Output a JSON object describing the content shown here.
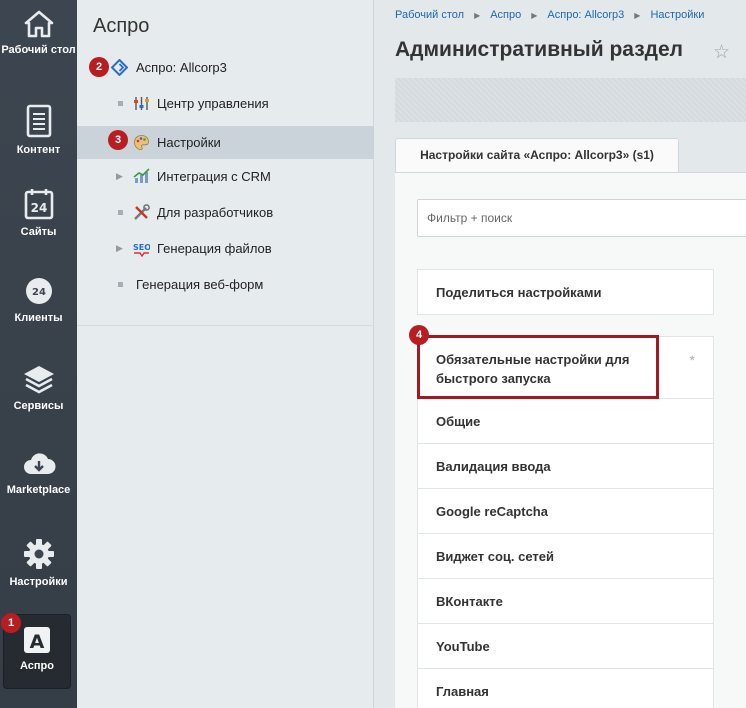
{
  "rail": [
    {
      "label": "Рабочий стол",
      "icon": "home-icon"
    },
    {
      "label": "Контент",
      "icon": "document-icon"
    },
    {
      "label": "Сайты",
      "icon": "calendar-24-icon"
    },
    {
      "label": "Клиенты",
      "icon": "clients-24-icon"
    },
    {
      "label": "Сервисы",
      "icon": "layers-icon"
    },
    {
      "label": "Marketplace",
      "icon": "cloud-download-icon"
    },
    {
      "label": "Настройки",
      "icon": "gear-icon"
    },
    {
      "label": "Аспро",
      "icon": "aspro-logo-icon"
    }
  ],
  "menu": {
    "title": "Аспро",
    "items": [
      {
        "label": "Аспро: Allcorp3",
        "icon": "allcorp-diamond-icon"
      },
      {
        "label": "Центр управления",
        "icon": "control-sliders-icon"
      },
      {
        "label": "Настройки",
        "icon": "palette-icon"
      },
      {
        "label": "Интеграция с CRM",
        "icon": "chart-icon"
      },
      {
        "label": "Для разработчиков",
        "icon": "tools-icon"
      },
      {
        "label": "Генерация файлов",
        "icon": "seo-icon"
      },
      {
        "label": "Генерация веб-форм",
        "icon": ""
      }
    ]
  },
  "breadcrumb": [
    "Рабочий стол",
    "Аспро",
    "Аспро: Allcorp3",
    "Настройки"
  ],
  "page_title": "Административный раздел",
  "tab_label": "Настройки сайта «Аспро: Allcorp3» (s1)",
  "filter_placeholder": "Фильтр + поиск",
  "share_label": "Поделиться настройками",
  "settings": [
    "Обязательные настройки для быстрого запуска",
    "Общие",
    "Валидация ввода",
    "Google reCaptcha",
    "Виджет соц. сетей",
    "ВКонтакте",
    "YouTube",
    "Главная"
  ],
  "required_mark": "*",
  "badges": [
    "1",
    "2",
    "3",
    "4"
  ],
  "colors": {
    "badge": "#b81d21",
    "link": "#2067b0",
    "rail": "#3d4650"
  }
}
